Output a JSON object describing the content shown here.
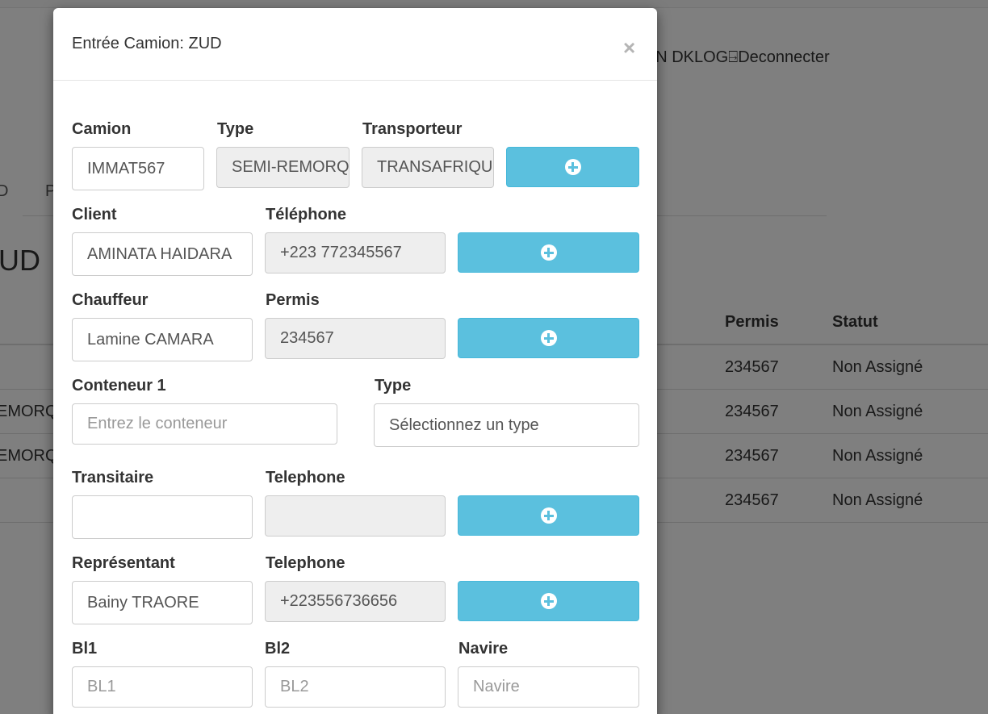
{
  "background": {
    "user_text": "MIN DKLOG⍈Deconnecter",
    "tab_1": "D",
    "tab_2": "P",
    "heading": "UD",
    "table": {
      "headers": {
        "permis": "Permis",
        "statut": "Statut"
      },
      "rows": [
        {
          "type": "",
          "permis": "234567",
          "statut": "Non Assigné"
        },
        {
          "type": "EMORQ",
          "permis": "234567",
          "statut": "Non Assigné"
        },
        {
          "type": "EMORQ",
          "permis": "234567",
          "statut": "Non Assigné"
        },
        {
          "type": "",
          "permis": "234567",
          "statut": "Non Assigné"
        }
      ]
    }
  },
  "modal": {
    "title": "Entrée Camion: ZUD",
    "close": "×",
    "camion": {
      "label": "Camion",
      "value": "IMMAT567"
    },
    "type": {
      "label": "Type",
      "value": "SEMI-REMORQUE"
    },
    "transporteur": {
      "label": "Transporteur",
      "value": "TRANSAFRIQUE"
    },
    "client": {
      "label": "Client",
      "value": "AMINATA HAIDARA"
    },
    "client_telephone": {
      "label": "Téléphone",
      "value": "+223 772345567"
    },
    "chauffeur": {
      "label": "Chauffeur",
      "value": "Lamine CAMARA"
    },
    "permis": {
      "label": "Permis",
      "value": "234567"
    },
    "conteneur1": {
      "label": "Conteneur 1",
      "placeholder": "Entrez le conteneur"
    },
    "conteneur_type": {
      "label": "Type",
      "value": "Sélectionnez un type"
    },
    "transitaire": {
      "label": "Transitaire",
      "value": ""
    },
    "transitaire_telephone": {
      "label": "Telephone",
      "value": ""
    },
    "representant": {
      "label": "Représentant",
      "value": "Bainy TRAORE"
    },
    "representant_telephone": {
      "label": "Telephone",
      "value": "+223556736656"
    },
    "bl1": {
      "label": "Bl1",
      "placeholder": "BL1"
    },
    "bl2": {
      "label": "Bl2",
      "placeholder": "BL2"
    },
    "navire": {
      "label": "Navire",
      "placeholder": "Navire"
    }
  },
  "colors": {
    "info_button": "#5bc0de",
    "readonly_bg": "#eeeeee",
    "overlay": "rgba(0,0,0,0.5)"
  },
  "icons": {
    "add_button": "plus-circle-icon",
    "close": "close-icon"
  }
}
